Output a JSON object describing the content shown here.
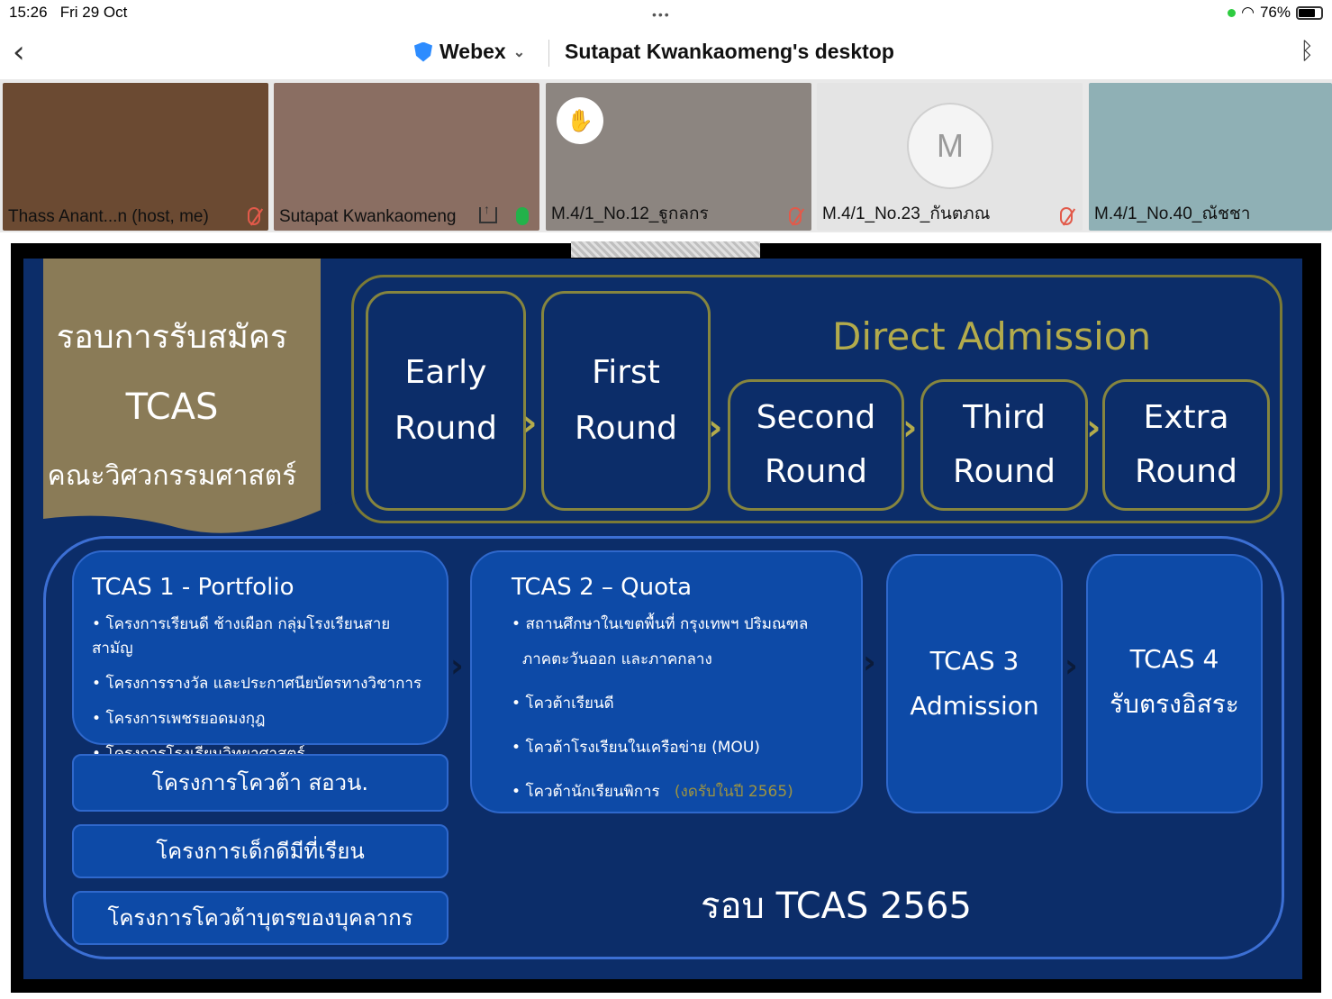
{
  "status": {
    "time": "15:26",
    "date": "Fri 29 Oct",
    "dots": "•••",
    "battery": "76%",
    "battery_level": 0.76
  },
  "nav": {
    "app": "Webex",
    "title": "Sutapat Kwankaomeng's desktop",
    "back_icon": "chevron-left-icon",
    "bt_icon": "bluetooth-icon"
  },
  "participants": [
    {
      "name": "Thass Anant...n (host, me)",
      "mic": "muted",
      "bg": "#6b4a32"
    },
    {
      "name": "Sutapat Kwankaomeng",
      "mic": "on",
      "bg": "#8a6e62"
    },
    {
      "name": "M.4/1_No.12_ฐูกลกร",
      "mic": "muted",
      "bg": "#8c8580"
    },
    {
      "name": "M.4/1_No.23_กันตภณ",
      "mic": "muted",
      "bg": "#e4e4e4",
      "initial": "M"
    },
    {
      "name": "M.4/1_No.40_ณัชชา",
      "mic": "none",
      "bg": "#8fb0b5"
    }
  ],
  "slide": {
    "heading_line1": "รอบการรับสมัคร",
    "heading_line2": "TCAS",
    "heading_line3": "คณะวิศวกรรมศาสตร์",
    "direct_admission": "Direct Admission",
    "rounds": [
      {
        "line1": "Early",
        "line2": "Round"
      },
      {
        "line1": "First",
        "line2": "Round"
      },
      {
        "line1": "Second",
        "line2": "Round"
      },
      {
        "line1": "Third",
        "line2": "Round"
      },
      {
        "line1": "Extra",
        "line2": "Round"
      }
    ],
    "tcas1": {
      "title": "TCAS 1 - Portfolio",
      "items": [
        "โครงการเรียนดี ช้างเผือก กลุ่มโรงเรียนสายสามัญ",
        "โครงการรางวัล และประกาศนียบัตรทางวิชาการ",
        "โครงการเพชรยอดมงกุฎ",
        "โครงการโรงเรียนวิทยาศาสตร์"
      ]
    },
    "bars": [
      "โครงการโควต้า สอวน.",
      "โครงการเด็กดีมีที่เรียน",
      "โครงการโควต้าบุตรของบุคลากร"
    ],
    "tcas2": {
      "title": "TCAS 2 – Quota",
      "item1_line1": "สถานศึกษาในเขตพื้นที่ กรุงเทพฯ ปริมณฑล",
      "item1_line2": "ภาคตะวันออก และภาคกลาง",
      "item2": "โควต้าเรียนดี",
      "item3": "โควต้าโรงเรียนในเครือข่าย (MOU)",
      "item4": "โควต้านักเรียนพิการ",
      "item4_note": "(งดรับในปี 2565)"
    },
    "tcas3": {
      "line1": "TCAS 3",
      "line2": "Admission"
    },
    "tcas4": {
      "line1": "TCAS 4",
      "line2": "รับตรงอิสระ"
    },
    "footer": "รอบ TCAS  2565"
  }
}
